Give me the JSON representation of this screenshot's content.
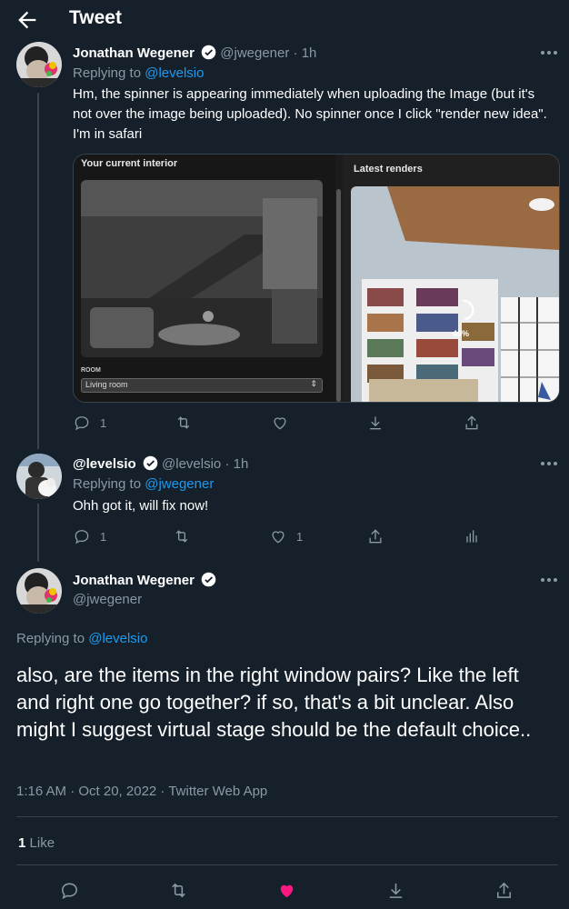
{
  "header": {
    "title": "Tweet"
  },
  "tweet1": {
    "name": "Jonathan Wegener",
    "handle": "@jwegener",
    "time": "· 1h",
    "replying_prefix": "Replying to",
    "replying_to": "@levelsio",
    "text": "Hm, the spinner is appearing immediately when uploading the Image (but it's not over the image being uploaded). No spinner once I click \"render new idea\". I'm in safari",
    "media": {
      "left_title": "Your current interior",
      "right_title": "Latest renders",
      "room_label": "ROOM",
      "room_value": "Living room",
      "progress_label": "46%",
      "progress": 46
    },
    "reply_count": "1"
  },
  "tweet2": {
    "name": "@levelsio",
    "handle": "@levelsio",
    "time": "· 1h",
    "replying_prefix": "Replying to",
    "replying_to": "@jwegener",
    "text": "Ohh got it, will fix now!",
    "reply_count": "1",
    "like_count": "1"
  },
  "main": {
    "name": "Jonathan Wegener",
    "handle": "@jwegener",
    "replying_prefix": "Replying to",
    "replying_to": "@levelsio",
    "text": "also, are the items in the right window pairs? Like the left and right one go together? if so, that's  a bit unclear.  Also might I suggest virtual stage should be the default choice..",
    "timestamp": "1:16 AM · Oct 20, 2022 · Twitter Web App",
    "likes_count": "1",
    "likes_label": "Like"
  },
  "colors": {
    "background": "#15202b",
    "accent": "#1d9bf0",
    "like": "#f91880",
    "muted": "#8b98a5"
  }
}
